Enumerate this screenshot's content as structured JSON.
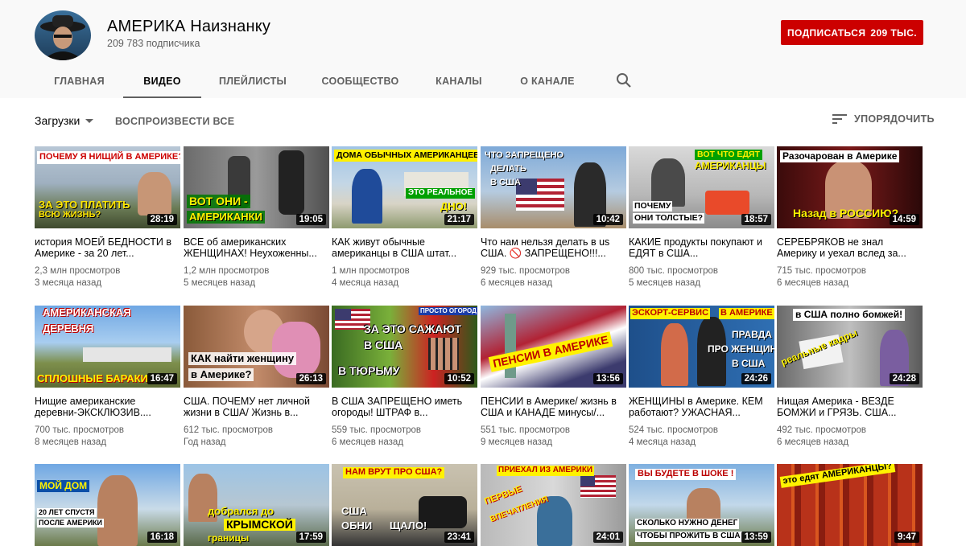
{
  "channel": {
    "name": "АМЕРИКА Наизнанку",
    "subscribers": "209 783 подписчика",
    "subscribe_label": "ПОДПИСАТЬСЯ",
    "subscribe_count": "209 ТЫС."
  },
  "tabs": [
    "ГЛАВНАЯ",
    "ВИДЕО",
    "ПЛЕЙЛИСТЫ",
    "СООБЩЕСТВО",
    "КАНАЛЫ",
    "О КАНАЛЕ"
  ],
  "active_tab": "ВИДЕО",
  "toolbar": {
    "uploads_label": "Загрузки",
    "play_all": "ВОСПРОИЗВЕСТИ ВСЕ",
    "sort_label": "УПОРЯДОЧИТЬ"
  },
  "videos": [
    {
      "title": "история МОЕЙ БЕДНОСТИ в Америке - за 20 лет...",
      "views": "2,3 млн просмотров",
      "age": "3 месяца назад",
      "duration": "28:19",
      "overlay": [
        "ПОЧЕМУ Я НИЩИЙ В АМЕРИКЕ?",
        "ЗА ЭТО ПЛАТИТЬ",
        "ВСЮ ЖИЗНЬ?"
      ]
    },
    {
      "title": "ВСЕ об американских ЖЕНЩИНАХ! Неухоженны...",
      "views": "1,2 млн просмотров",
      "age": "5 месяцев назад",
      "duration": "19:05",
      "overlay": [
        "ВОТ ОНИ -",
        "АМЕРИКАНКИ"
      ]
    },
    {
      "title": "КАК живут обычные американцы в США штат...",
      "views": "1 млн просмотров",
      "age": "4 месяца назад",
      "duration": "21:17",
      "overlay": [
        "ДОМА ОБЫЧНЫХ АМЕРИКАНЦЕВ",
        "ЭТО РЕАЛЬНОЕ",
        "ДНО!"
      ]
    },
    {
      "title": "Что нам нельзя делать в us США. 🚫 ЗАПРЕЩЕНО!!!...",
      "views": "929 тыс. просмотров",
      "age": "6 месяцев назад",
      "duration": "10:42",
      "overlay": [
        "ЧТО ЗАПРЕЩЕНО",
        "ДЕЛАТЬ",
        "В США"
      ]
    },
    {
      "title": "КАКИЕ продукты покупают и ЕДЯТ в США...",
      "views": "800 тыс. просмотров",
      "age": "5 месяцев назад",
      "duration": "18:57",
      "overlay": [
        "ВОТ ЧТО ЕДЯТ",
        "АМЕРИКАНЦЫ",
        "ПОЧЕМУ",
        "ОНИ ТОЛСТЫЕ?"
      ]
    },
    {
      "title": "СЕРЕБРЯКОВ не знал Америку и уехал вслед за...",
      "views": "715 тыс. просмотров",
      "age": "6 месяцев назад",
      "duration": "14:59",
      "overlay": [
        "Разочарован в Америке",
        "Назад в РОССИЮ?"
      ]
    },
    {
      "title": "Нищие американские деревни-ЭКСКЛЮЗИВ....",
      "views": "700 тыс. просмотров",
      "age": "8 месяцев назад",
      "duration": "16:47",
      "overlay": [
        "АМЕРИКАНСКАЯ",
        "ДЕРЕВНЯ",
        "СПЛОШНЫЕ БАРАКИ"
      ]
    },
    {
      "title": "США. ПОЧЕМУ нет личной жизни в США/ Жизнь в...",
      "views": "612 тыс. просмотров",
      "age": "Год назад",
      "duration": "26:13",
      "overlay": [
        "КАК найти женщину",
        "в Америке?"
      ]
    },
    {
      "title": "В США ЗАПРЕЩЕНО иметь огороды! ШТРАФ в...",
      "views": "559 тыс. просмотров",
      "age": "6 месяцев назад",
      "duration": "10:52",
      "overlay": [
        "ПРОСТО ОГОРОД",
        "ЗА ЭТО САЖАЮТ",
        "В США",
        "В ТЮРЬМУ"
      ]
    },
    {
      "title": "ПЕНСИИ в Америке/ жизнь в США и КАНАДЕ минусы/...",
      "views": "551 тыс. просмотров",
      "age": "9 месяцев назад",
      "duration": "13:56",
      "overlay": [
        "ПЕНСИИ В АМЕРИКЕ"
      ]
    },
    {
      "title": "ЖЕНЩИНЫ в Америке. КЕМ работают? УЖАСНАЯ...",
      "views": "524 тыс. просмотров",
      "age": "4 месяца назад",
      "duration": "24:26",
      "overlay": [
        "ЭСКОРТ-СЕРВИС",
        "В АМЕРИКЕ",
        "ПРАВДА",
        "ПРО ЖЕНЩИН",
        "В США"
      ]
    },
    {
      "title": "Нищая Америка - ВЕЗДЕ БОМЖИ и ГРЯЗЬ. США...",
      "views": "492 тыс. просмотров",
      "age": "6 месяцев назад",
      "duration": "24:28",
      "overlay": [
        "в США полно бомжей!",
        "реальные кадры"
      ]
    },
    {
      "title": "",
      "views": "",
      "age": "",
      "duration": "16:18",
      "overlay": [
        "МОЙ ДОМ",
        "20 ЛЕТ СПУСТЯ",
        "ПОСЛЕ АМЕРИКИ"
      ]
    },
    {
      "title": "",
      "views": "",
      "age": "",
      "duration": "17:59",
      "overlay": [
        "добрался до",
        "КРЫМСКОЙ",
        "границы"
      ]
    },
    {
      "title": "",
      "views": "",
      "age": "",
      "duration": "23:41",
      "overlay": [
        "НАМ ВРУТ ПРО США?",
        "США",
        "ОБНИ",
        "ЩАЛО!"
      ]
    },
    {
      "title": "",
      "views": "",
      "age": "",
      "duration": "24:01",
      "overlay": [
        "ПРИЕХАЛ ИЗ АМЕРИКИ",
        "ПЕРВЫЕ",
        "ВПЕЧАТЛЕНИЯ"
      ]
    },
    {
      "title": "",
      "views": "",
      "age": "",
      "duration": "13:59",
      "overlay": [
        "ВЫ БУДЕТЕ В ШОКЕ !",
        "СКОЛЬКО НУЖНО ДЕНЕГ",
        "ЧТОБЫ ПРОЖИТЬ В США"
      ]
    },
    {
      "title": "",
      "views": "",
      "age": "",
      "duration": "9:47",
      "overlay": [
        "это едят АМЕРИКАНЦЫ?"
      ]
    }
  ],
  "colors": {
    "subscribe": "#cc0000",
    "accent_text": "#606060"
  }
}
